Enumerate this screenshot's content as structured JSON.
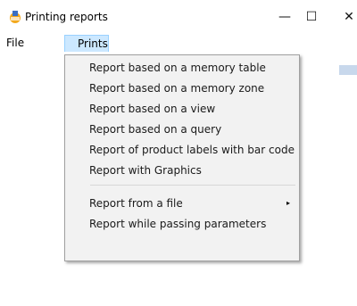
{
  "window": {
    "title": "Printing reports",
    "minimize_glyph": "—",
    "maximize_glyph": "☐",
    "close_glyph": "✕",
    "icon": "printer-app-icon"
  },
  "menubar": {
    "items": [
      {
        "label": "File"
      },
      {
        "label": "Prints"
      }
    ]
  },
  "prints_menu": {
    "items": [
      {
        "label": "Report based on a memory table"
      },
      {
        "label": "Report based on a memory zone"
      },
      {
        "label": "Report based on a view"
      },
      {
        "label": "Report based on a query"
      },
      {
        "label": "Report of product labels with bar code"
      },
      {
        "label": "Report with Graphics"
      },
      {
        "label": "Report from a file",
        "submenu_arrow": "▸"
      },
      {
        "label": "Report while passing parameters"
      }
    ]
  },
  "colors": {
    "menu_highlight": "#cce8ff",
    "menu_highlight_border": "#99d1ff",
    "dropdown_bg": "#f2f2f2"
  }
}
